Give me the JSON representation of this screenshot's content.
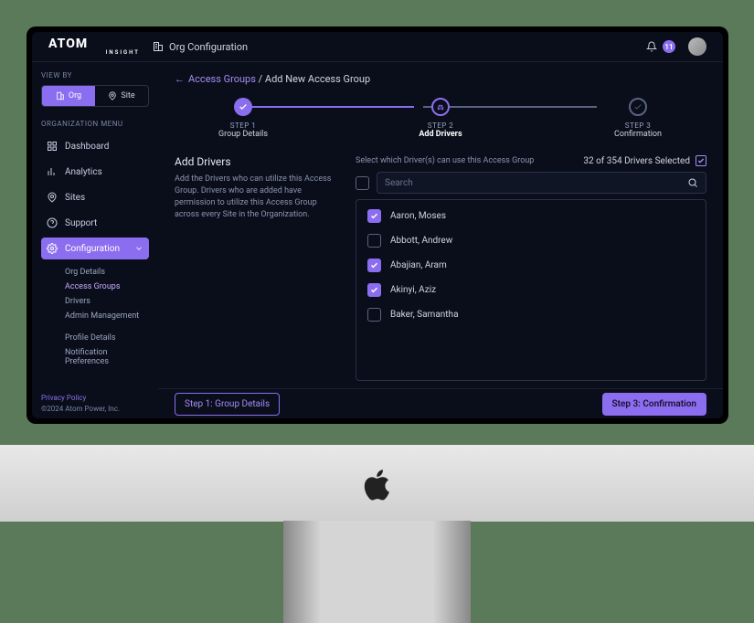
{
  "logo": {
    "main": "ATOM",
    "sub": "INSIGHT"
  },
  "header": {
    "title": "Org Configuration",
    "notification_count": "11"
  },
  "sidebar": {
    "viewby_label": "VIEW BY",
    "seg": {
      "org": "Org",
      "site": "Site"
    },
    "menu_label": "ORGANIZATION MENU",
    "items": [
      {
        "label": "Dashboard"
      },
      {
        "label": "Analytics"
      },
      {
        "label": "Sites"
      },
      {
        "label": "Support"
      },
      {
        "label": "Configuration"
      }
    ],
    "sub_items": [
      {
        "label": "Org Details"
      },
      {
        "label": "Access Groups"
      },
      {
        "label": "Drivers"
      },
      {
        "label": "Admin Management"
      },
      {
        "label": "Profile Details"
      },
      {
        "label": "Notification Preferences"
      }
    ],
    "privacy": "Privacy Policy",
    "copyright": "©2024 Atom Power, Inc."
  },
  "breadcrumb": {
    "back_link": "Access Groups",
    "rest": " / Add New Access Group"
  },
  "stepper": {
    "s1": {
      "num": "STEP 1",
      "name": "Group Details"
    },
    "s2": {
      "num": "STEP 2",
      "name": "Add Drivers"
    },
    "s3": {
      "num": "STEP 3",
      "name": "Confirmation"
    }
  },
  "section": {
    "title": "Add Drivers",
    "desc": "Add the Drivers who can utilize this Access Group. Drivers who are added have permission to utilize this Access Group across every Site in the Organization."
  },
  "selection": {
    "label": "Select which Driver(s) can use this Access Group",
    "count_text": "32 of 354 Drivers Selected",
    "search_placeholder": "Search"
  },
  "drivers": [
    {
      "name": "Aaron, Moses",
      "checked": true
    },
    {
      "name": "Abbott, Andrew",
      "checked": false
    },
    {
      "name": "Abajian, Aram",
      "checked": true
    },
    {
      "name": "Akinyi, Aziz",
      "checked": true
    },
    {
      "name": "Baker, Samantha",
      "checked": false
    }
  ],
  "footer": {
    "back": "Step 1: Group Details",
    "next": "Step 3: Confirmation"
  }
}
